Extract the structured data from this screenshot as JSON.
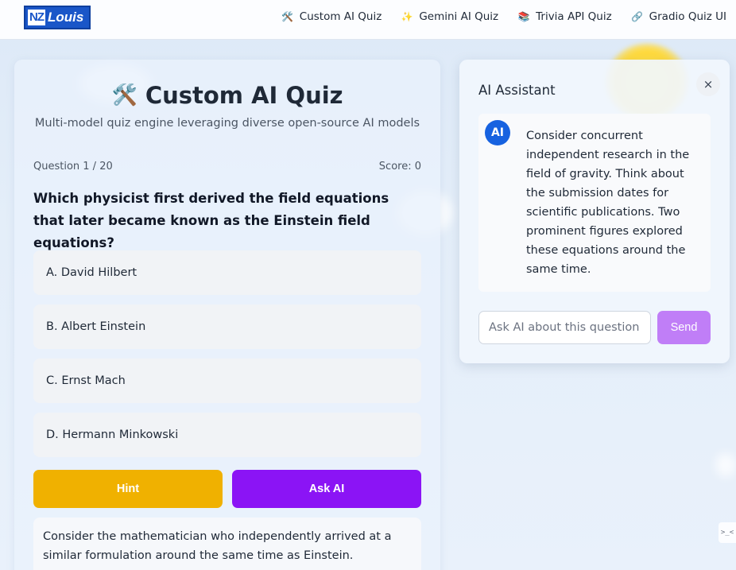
{
  "brand": {
    "logo_box": "NZ",
    "logo_word": "Louis"
  },
  "nav": [
    {
      "icon": "🛠️",
      "label": "Custom AI Quiz"
    },
    {
      "icon": "✨",
      "label": "Gemini AI Quiz"
    },
    {
      "icon": "📚",
      "label": "Trivia API Quiz"
    },
    {
      "icon": "🔗",
      "label": "Gradio Quiz UI"
    }
  ],
  "quiz": {
    "title_icon": "🛠️",
    "title": "Custom AI Quiz",
    "subtitle": "Multi-model quiz engine leveraging diverse open-source AI models",
    "progress": "Question 1 / 20",
    "score": "Score: 0",
    "question": "Which physicist first derived the field equations that later became known as the Einstein field equations?",
    "options": [
      "A. David Hilbert",
      "B. Albert Einstein",
      "C. Ernst Mach",
      "D. Hermann Minkowski"
    ],
    "hint_label": "Hint",
    "ask_label": "Ask AI",
    "hint_text": "Consider the mathematician who independently arrived at a similar formulation around the same time as Einstein."
  },
  "assistant": {
    "title": "AI Assistant",
    "close_symbol": "×",
    "avatar": "AI",
    "message": "Consider concurrent independent research in the field of gravity. Think about the submission dates for scientific publications. Two prominent figures explored these equations around the same time.",
    "input_placeholder": "Ask AI about this question...",
    "send_label": "Send"
  },
  "corner_badge": ">_<",
  "colors": {
    "hint_button": "#f0b100",
    "ask_button": "#8b14f5",
    "send_button": "#c07ef7",
    "avatar": "#1762e0",
    "logo": "#1a56c8"
  }
}
